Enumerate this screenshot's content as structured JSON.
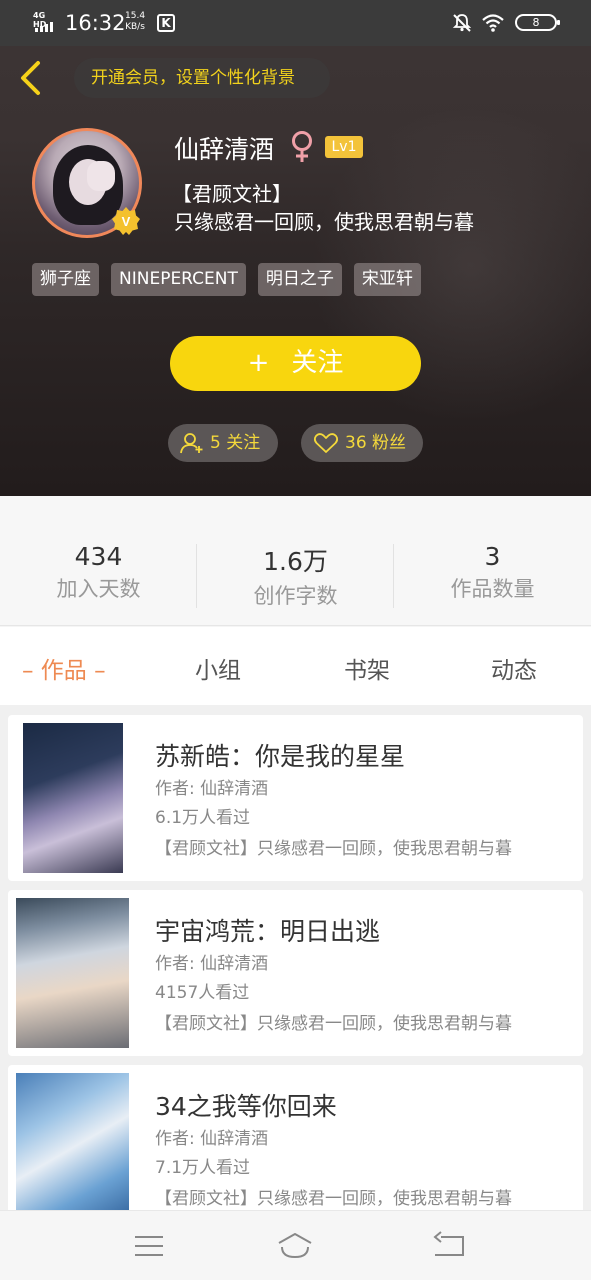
{
  "status_bar": {
    "network": "4G HD",
    "time": "16:32",
    "speed_value": "15.4",
    "speed_unit": "KB/s",
    "app_indicator": "K",
    "battery": "8"
  },
  "header": {
    "vip_prompt": "开通会员，设置个性化背景",
    "nickname": "仙辞清酒",
    "level": "Lv1",
    "bio_line1": "【君顾文社】",
    "bio_line2": "只缘感君一回顾，使我思君朝与暮",
    "tags": [
      "狮子座",
      "NINEPERCENT",
      "明日之子",
      "宋亚轩"
    ],
    "follow_plus": "+",
    "follow_label": "关注",
    "following_count": "5 关注",
    "fans_count": "36 粉丝",
    "accent_color": "#f8d60e"
  },
  "stats": [
    {
      "value": "434",
      "label": "加入天数"
    },
    {
      "value": "1.6万",
      "label": "创作字数"
    },
    {
      "value": "3",
      "label": "作品数量"
    }
  ],
  "tabs": [
    {
      "label": "– 作品 –",
      "active": true
    },
    {
      "label": "小组",
      "active": false
    },
    {
      "label": "书架",
      "active": false
    },
    {
      "label": "动态",
      "active": false
    }
  ],
  "works": [
    {
      "title": "苏新皓：你是我的星星",
      "author": "作者: 仙辞清酒",
      "views": "6.1万人看过",
      "desc": "【君顾文社】只缘感君一回顾，使我思君朝与暮"
    },
    {
      "title": "宇宙鸿荒：明日出逃",
      "author": "作者: 仙辞清酒",
      "views": "4157人看过",
      "desc": "【君顾文社】只缘感君一回顾，使我思君朝与暮"
    },
    {
      "title": "34之我等你回来",
      "author": "作者: 仙辞清酒",
      "views": "7.1万人看过",
      "desc": "【君顾文社】只缘感君一回顾，使我思君朝与暮"
    }
  ],
  "icons": {
    "back": "chevron-left-icon",
    "gender": "female-icon",
    "vip_badge": "v-badge-icon",
    "following": "person-add-icon",
    "fans": "heart-icon",
    "nav": [
      "menu-icon",
      "home-icon",
      "back-icon"
    ]
  }
}
